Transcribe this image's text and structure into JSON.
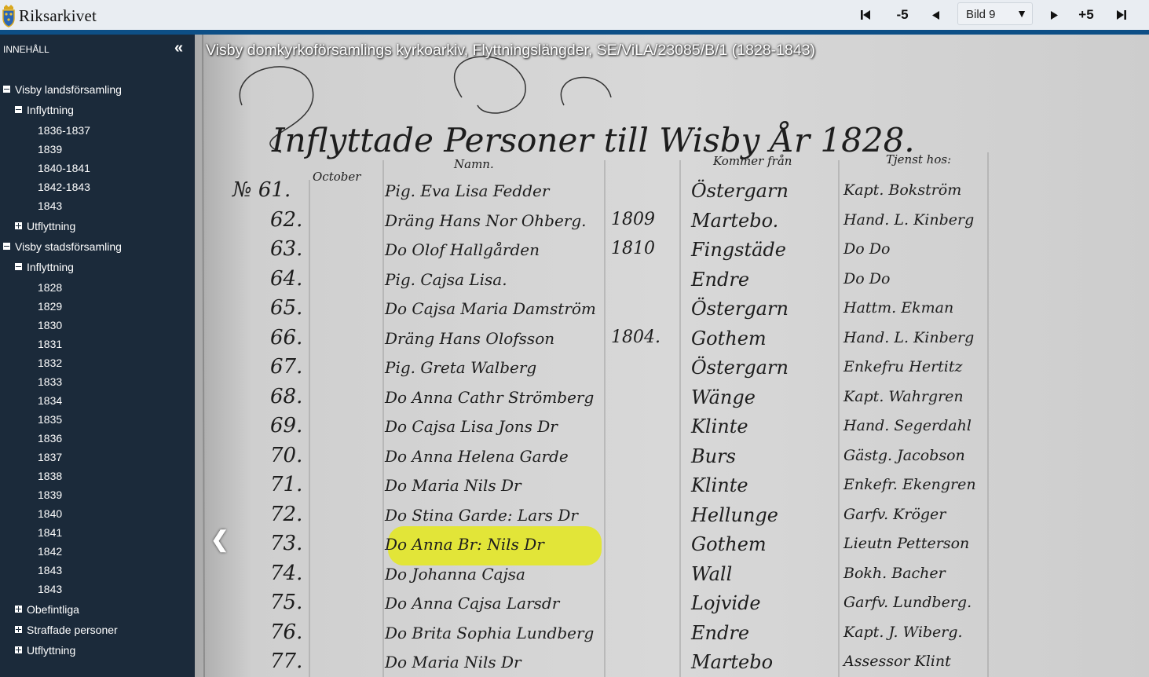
{
  "app": {
    "logo_text": "Riksarkivet"
  },
  "toolbar": {
    "first_icon": "skip-to-first-icon",
    "minus5_label": "-5",
    "prev_icon": "triangle-left-icon",
    "page_select_value": "Bild 9",
    "next_icon": "triangle-right-icon",
    "plus5_label": "+5",
    "last_icon": "skip-to-last-icon"
  },
  "sidebar": {
    "header": "INNEHÅLL",
    "collapse_icon": "double-chevron-left-icon",
    "tree": [
      {
        "label": "Visby landsförsamling",
        "level": 0,
        "toggle": "minus"
      },
      {
        "label": "Inflyttning",
        "level": 1,
        "toggle": "minus"
      },
      {
        "label": "1836-1837",
        "level": 2
      },
      {
        "label": "1839",
        "level": 2
      },
      {
        "label": "1840-1841",
        "level": 2
      },
      {
        "label": "1842-1843",
        "level": 2
      },
      {
        "label": "1843",
        "level": 2
      },
      {
        "label": "Utflyttning",
        "level": 1,
        "toggle": "plus"
      },
      {
        "label": "Visby stadsförsamling",
        "level": 0,
        "toggle": "minus"
      },
      {
        "label": "Inflyttning",
        "level": 1,
        "toggle": "minus"
      },
      {
        "label": "1828",
        "level": 2
      },
      {
        "label": "1829",
        "level": 2
      },
      {
        "label": "1830",
        "level": 2
      },
      {
        "label": "1831",
        "level": 2
      },
      {
        "label": "1832",
        "level": 2
      },
      {
        "label": "1833",
        "level": 2
      },
      {
        "label": "1834",
        "level": 2
      },
      {
        "label": "1835",
        "level": 2
      },
      {
        "label": "1836",
        "level": 2
      },
      {
        "label": "1837",
        "level": 2
      },
      {
        "label": "1838",
        "level": 2
      },
      {
        "label": "1839",
        "level": 2
      },
      {
        "label": "1840",
        "level": 2
      },
      {
        "label": "1841",
        "level": 2
      },
      {
        "label": "1842",
        "level": 2
      },
      {
        "label": "1843",
        "level": 2
      },
      {
        "label": "1843",
        "level": 2
      },
      {
        "label": "Obefintliga",
        "level": 1,
        "toggle": "plus"
      },
      {
        "label": "Straffade personer",
        "level": 1,
        "toggle": "plus"
      },
      {
        "label": "Utflyttning",
        "level": 1,
        "toggle": "plus"
      }
    ]
  },
  "viewer": {
    "document_title": "Visby domkyrkoförsamlings kyrkoarkiv, Flyttningslängder, SE/ViLA/23085/B/1 (1828-1843)",
    "prev_image_icon": "chevron-left-icon",
    "highlight_color": "#e3e62a",
    "scan": {
      "heading": "Inflyttade Personer till Wisby År 1828.",
      "month": "October",
      "col_name": "Namn.",
      "col_from": "Kommer från",
      "col_host": "Tjenst hos:",
      "rows": [
        {
          "no": "№ 61.",
          "name": "Pig. Eva Lisa Fedder",
          "year": "",
          "from": "Östergarn",
          "host": "Kapt. Bokström"
        },
        {
          "no": "62.",
          "name": "Dräng Hans Nor Ohberg.",
          "year": "1809",
          "from": "Martebo.",
          "host": "Hand. L. Kinberg"
        },
        {
          "no": "63.",
          "name": "Do Olof Hallgården",
          "year": "1810",
          "from": "Fingstäde",
          "host": "Do Do"
        },
        {
          "no": "64.",
          "name": "Pig. Cajsa Lisa.",
          "year": "",
          "from": "Endre",
          "host": "Do Do"
        },
        {
          "no": "65.",
          "name": "Do Cajsa Maria Damström",
          "year": "",
          "from": "Östergarn",
          "host": "Hattm. Ekman"
        },
        {
          "no": "66.",
          "name": "Dräng Hans Olofsson",
          "year": "1804.",
          "from": "Gothem",
          "host": "Hand. L. Kinberg"
        },
        {
          "no": "67.",
          "name": "Pig. Greta Walberg",
          "year": "",
          "from": "Östergarn",
          "host": "Enkefru Hertitz"
        },
        {
          "no": "68.",
          "name": "Do Anna Cathr Strömberg",
          "year": "",
          "from": "Wänge",
          "host": "Kapt. Wahrgren"
        },
        {
          "no": "69.",
          "name": "Do Cajsa Lisa Jons Dr",
          "year": "",
          "from": "Klinte",
          "host": "Hand. Segerdahl"
        },
        {
          "no": "70.",
          "name": "Do Anna Helena Garde",
          "year": "",
          "from": "Burs",
          "host": "Gästg. Jacobson"
        },
        {
          "no": "71.",
          "name": "Do Maria Nils Dr",
          "year": "",
          "from": "Klinte",
          "host": "Enkefr. Ekengren"
        },
        {
          "no": "72.",
          "name": "Do Stina Garde: Lars Dr",
          "year": "",
          "from": "Hellunge",
          "host": "Garfv. Kröger"
        },
        {
          "no": "73.",
          "name": "Do Anna Br: Nils Dr",
          "year": "",
          "from": "Gothem",
          "host": "Lieutn Petterson",
          "highlight": true
        },
        {
          "no": "74.",
          "name": "Do Johanna Cajsa",
          "year": "",
          "from": "Wall",
          "host": "Bokh. Bacher"
        },
        {
          "no": "75.",
          "name": "Do Anna Cajsa Larsdr",
          "year": "",
          "from": "Lojvide",
          "host": "Garfv. Lundberg."
        },
        {
          "no": "76.",
          "name": "Do Brita Sophia Lundberg",
          "year": "",
          "from": "Endre",
          "host": "Kapt. J. Wiberg."
        },
        {
          "no": "77.",
          "name": "Do Maria Nils Dr",
          "year": "",
          "from": "Martebo",
          "host": "Assessor Klint"
        }
      ]
    }
  }
}
